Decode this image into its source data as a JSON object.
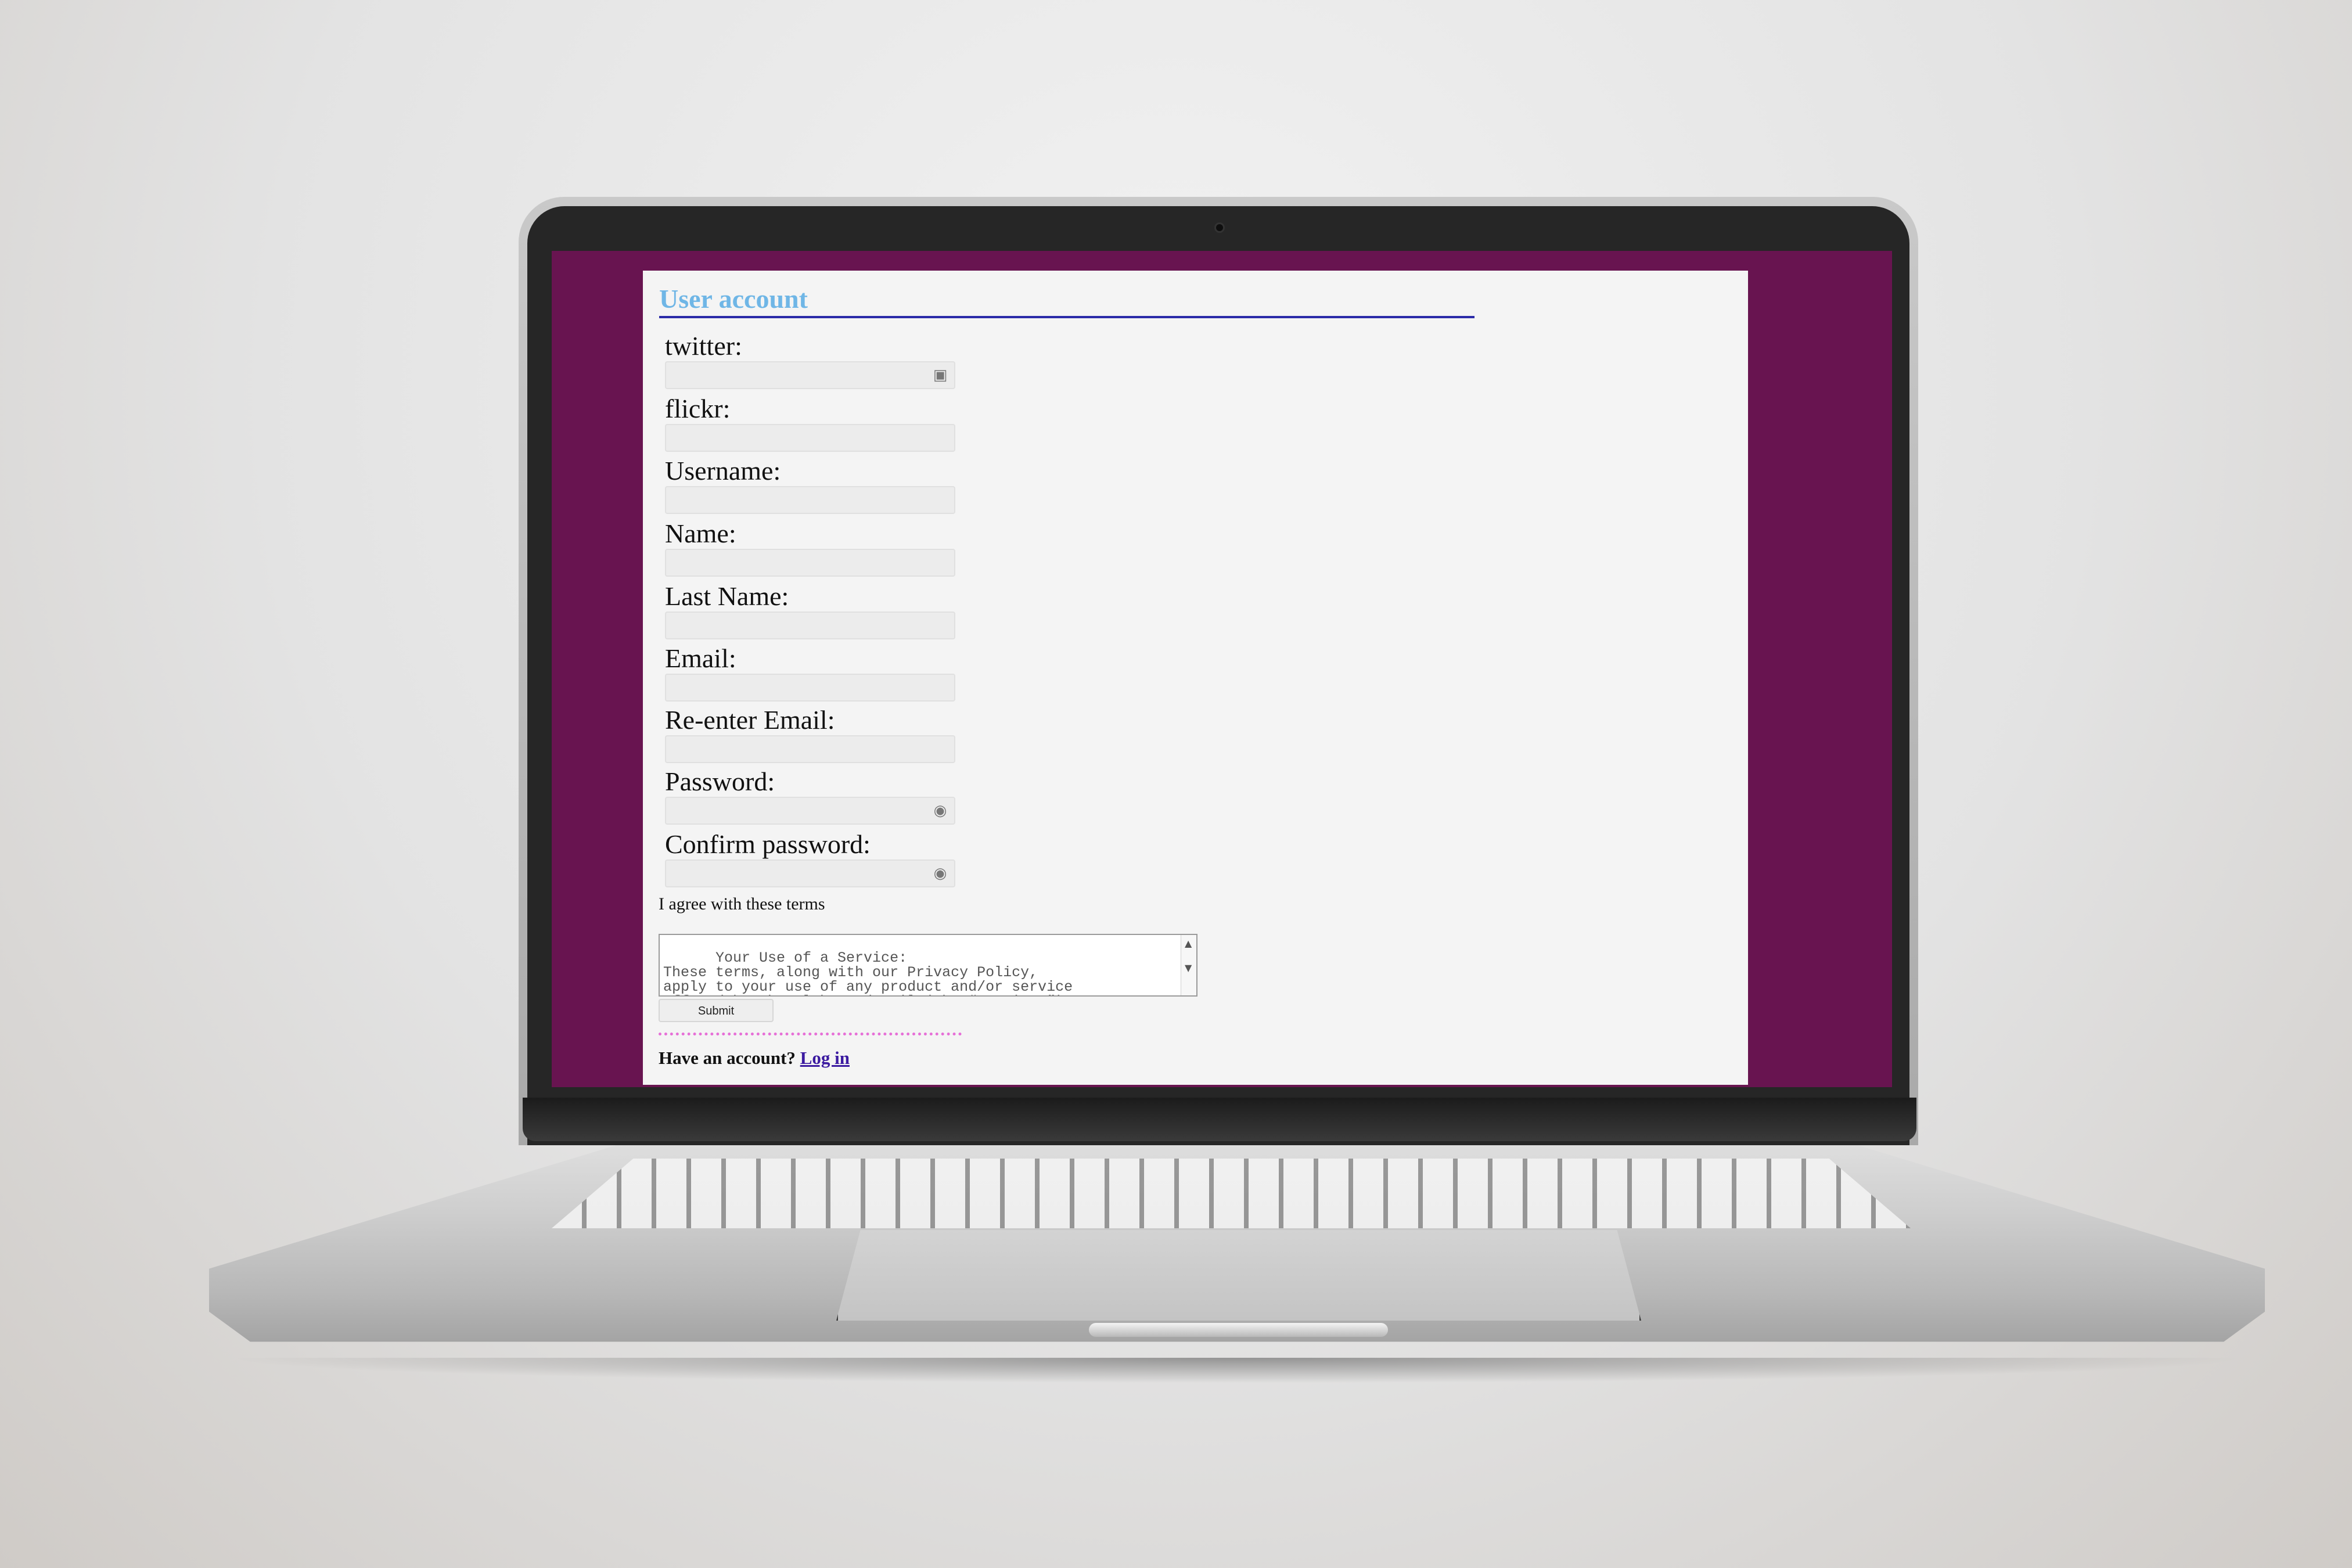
{
  "colors": {
    "screen_background": "#681450",
    "page_background": "#f4f4f4",
    "title": "#6fb6e6",
    "title_rule": "#2b2ba8",
    "divider": "#e66fd7",
    "link": "#3b1aa0"
  },
  "form": {
    "title": "User account",
    "fields": [
      {
        "label": "twitter:",
        "value": "",
        "icon": "contact-card-icon"
      },
      {
        "label": "flickr:",
        "value": ""
      },
      {
        "label": "Username:",
        "value": ""
      },
      {
        "label": "Name:",
        "value": ""
      },
      {
        "label": "Last Name:",
        "value": ""
      },
      {
        "label": "Email:",
        "value": ""
      },
      {
        "label": "Re-enter Email:",
        "value": ""
      },
      {
        "label": "Password:",
        "value": "",
        "icon": "eye-icon"
      },
      {
        "label": "Confirm password:",
        "value": "",
        "icon": "eye-icon"
      }
    ],
    "agree_label": "I agree with these terms",
    "terms_text": "Your Use of a Service:\nThese terms, along with our Privacy Policy,\napply to your use of any product and/or service\noffered by The Globe and Mail (the “Services”).",
    "submit_label": "Submit",
    "have_account_text": "Have an account?",
    "login_link": "Log in"
  }
}
